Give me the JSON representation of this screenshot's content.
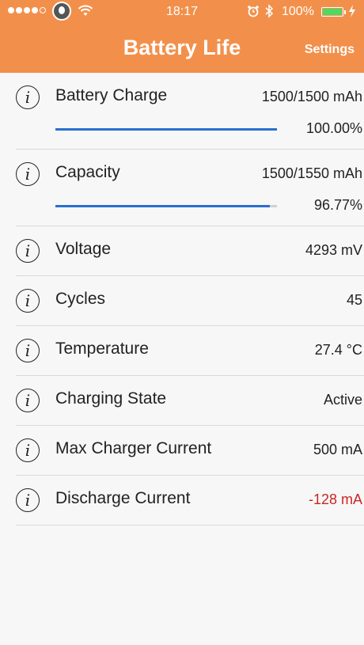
{
  "status_bar": {
    "time": "18:17",
    "battery_percent": "100%",
    "signal_dots_filled": 4,
    "signal_dots_total": 5,
    "icons": [
      "signal-dots",
      "carrier-icon",
      "wifi-icon",
      "alarm-icon",
      "bluetooth-icon",
      "battery-icon",
      "charging-bolt-icon"
    ]
  },
  "nav": {
    "title": "Battery Life",
    "settings_label": "Settings",
    "background_color": "#f2904b"
  },
  "rows": [
    {
      "label": "Battery Charge",
      "value": "1500/1500 mAh",
      "percent_label": "100.00%",
      "progress": 1.0
    },
    {
      "label": "Capacity",
      "value": "1500/1550 mAh",
      "percent_label": "96.77%",
      "progress": 0.9677
    },
    {
      "label": "Voltage",
      "value": "4293 mV"
    },
    {
      "label": "Cycles",
      "value": "45"
    },
    {
      "label": "Temperature",
      "value": "27.4 °C"
    },
    {
      "label": "Charging State",
      "value": "Active"
    },
    {
      "label": "Max Charger Current",
      "value": "500 mA"
    },
    {
      "label": "Discharge Current",
      "value": "-128 mA",
      "value_color": "#cc2525"
    }
  ],
  "info_icon_glyph": "i",
  "colors": {
    "progress_fill": "#2a6fcf",
    "negative_value": "#cc2525"
  }
}
